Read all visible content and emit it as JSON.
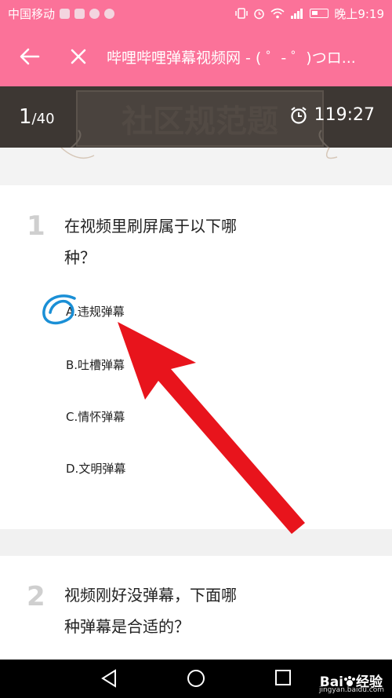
{
  "status": {
    "carrier": "中国移动",
    "time_label": "晚上9:19"
  },
  "titlebar": {
    "title": "哔哩哔哩弹幕视频网 - ( ゜- ゜)つロ..."
  },
  "quiz": {
    "current": "1",
    "total": "/40",
    "timer": "119:27",
    "banner_text": "社区规范题"
  },
  "questions": [
    {
      "number": "1",
      "line1": "在视频里刷屏属于以下哪",
      "line2": "种？",
      "options": [
        "A.违规弹幕",
        "B.吐槽弹幕",
        "C.情怀弹幕",
        "D.文明弹幕"
      ]
    },
    {
      "number": "2",
      "line1": "视频刚好没弹幕，下面哪",
      "line2": "种弹幕是合适的？"
    }
  ],
  "watermark": {
    "brand": "Bai",
    "brand_tail": "经验",
    "url": "jingyan.baidu.com"
  },
  "colors": {
    "accent": "#fb7299",
    "quizbar": "#3d3733",
    "annotation_red": "#e8141c",
    "annotation_blue": "#1a8fd6"
  }
}
